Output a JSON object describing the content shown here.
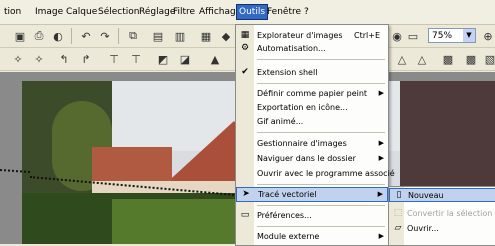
{
  "menubar": {
    "items": [
      {
        "label": "tion",
        "active": false
      },
      {
        "label": "Image",
        "active": false
      },
      {
        "label": "Calque",
        "active": false
      },
      {
        "label": "Sélection",
        "active": false
      },
      {
        "label": "Réglage",
        "active": false
      },
      {
        "label": "Filtre",
        "active": false
      },
      {
        "label": "Affichage",
        "active": false
      },
      {
        "label": "Outils",
        "active": true
      },
      {
        "label": "Fenêtre",
        "active": false
      },
      {
        "label": "?",
        "active": false
      }
    ]
  },
  "toolbar": {
    "zoom_value": "75%"
  },
  "outils_menu": {
    "items": [
      {
        "label": "Explorateur d'images",
        "shortcut": "Ctrl+E",
        "icon": "image-browser-icon"
      },
      {
        "label": "Automatisation...",
        "icon": "automation-icon"
      },
      {
        "label": "Extension shell",
        "icon": "checkmark-icon"
      },
      {
        "label": "Définir comme papier peint",
        "submenu": true
      },
      {
        "label": "Exportation en icône..."
      },
      {
        "label": "Gif animé..."
      },
      {
        "label": "Gestionnaire d'images",
        "submenu": true
      },
      {
        "label": "Naviguer dans le dossier",
        "submenu": true
      },
      {
        "label": "Ouvrir avec le programme associé"
      },
      {
        "label": "Tracé vectoriel",
        "submenu": true,
        "highlighted": true,
        "icon": "vector-arrow-icon"
      },
      {
        "label": "Préférences...",
        "icon": "preferences-icon"
      },
      {
        "label": "Module externe",
        "submenu": true
      }
    ]
  },
  "vector_submenu": {
    "items": [
      {
        "label": "Nouveau",
        "highlighted": true,
        "icon": "new-document-icon"
      },
      {
        "label": "Convertir la sélection",
        "disabled": true,
        "icon": "convert-selection-icon"
      },
      {
        "label": "Ouvrir...",
        "icon": "open-folder-icon"
      }
    ]
  }
}
